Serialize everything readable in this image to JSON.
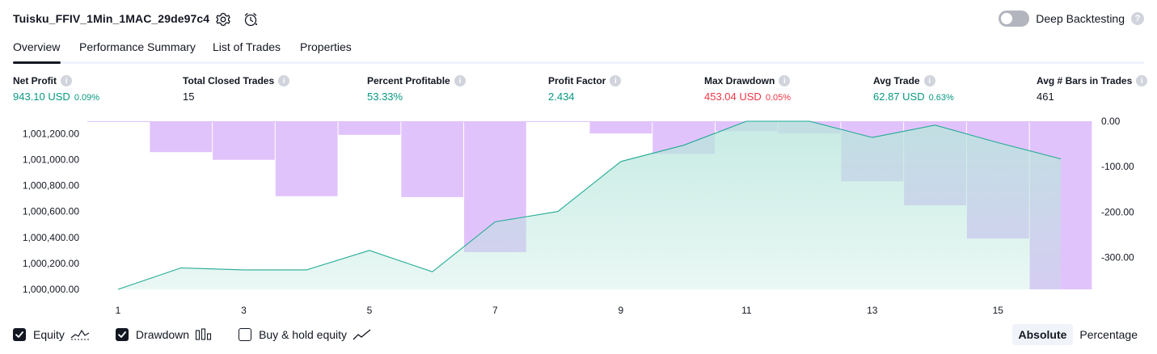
{
  "header": {
    "title": "Tuisku_FFIV_1Min_1MAC_29de97c4",
    "deep_backtesting_label": "Deep Backtesting",
    "deep_backtesting_enabled": false,
    "help_glyph": "?",
    "icons": [
      "settings-icon",
      "alert-clock-icon",
      "help-icon"
    ]
  },
  "tabs": [
    {
      "label": "Overview",
      "active": true
    },
    {
      "label": "Performance Summary",
      "active": false
    },
    {
      "label": "List of Trades",
      "active": false
    },
    {
      "label": "Properties",
      "active": false
    }
  ],
  "metrics": {
    "info_glyph": "i",
    "net_profit": {
      "label": "Net Profit",
      "value": "943.10 USD",
      "pct": "0.09%"
    },
    "total_closed_trades": {
      "label": "Total Closed Trades",
      "value": "15"
    },
    "percent_profitable": {
      "label": "Percent Profitable",
      "value": "53.33%"
    },
    "profit_factor": {
      "label": "Profit Factor",
      "value": "2.434"
    },
    "max_drawdown": {
      "label": "Max Drawdown",
      "value": "453.04 USD",
      "pct": "0.05%"
    },
    "avg_trade": {
      "label": "Avg Trade",
      "value": "62.87 USD",
      "pct": "0.63%"
    },
    "avg_bars": {
      "label": "Avg # Bars in Trades",
      "value": "461"
    }
  },
  "colors": {
    "green": "#089981",
    "red": "#f23645",
    "equity_line": "#22ab94",
    "equity_fill": "#b9e6dc",
    "drawdown_bar": "#e1c3fb"
  },
  "chart_data": {
    "type": "area",
    "x": [
      1,
      2,
      3,
      4,
      5,
      6,
      7,
      8,
      9,
      10,
      11,
      12,
      13,
      14,
      15,
      16
    ],
    "x_tick_labels": [
      "1",
      "3",
      "5",
      "7",
      "9",
      "11",
      "13",
      "15"
    ],
    "xlim": [
      1,
      16.55
    ],
    "series": [
      {
        "kind": "area",
        "axis": "left",
        "values": [
          1000000,
          1000165,
          1000150,
          1000150,
          1000300,
          1000135,
          1000520,
          1000600,
          1000985,
          1001110,
          1001295,
          1001295,
          1001170,
          1001265,
          1001130,
          1001005
        ]
      },
      {
        "kind": "bar",
        "axis": "right",
        "values": [
          0,
          -68,
          -85,
          -165,
          -30,
          -167,
          -288,
          0,
          -27,
          -72,
          -22,
          -27,
          -132,
          -185,
          -258,
          -370
        ]
      }
    ],
    "y_left": {
      "ticks": [
        "1,000,000.00",
        "1,000,200.00",
        "1,000,400.00",
        "1,000,600.00",
        "1,000,800.00",
        "1,001,000.00",
        "1,001,200.00"
      ],
      "lim": [
        1000000,
        1001295
      ]
    },
    "y_right": {
      "ticks": [
        "0.00",
        "-100.00",
        "-200.00",
        "-300.00"
      ],
      "lim": [
        -370,
        0
      ]
    },
    "grid": false
  },
  "legend": {
    "equity": {
      "label": "Equity",
      "checked": true
    },
    "drawdown": {
      "label": "Drawdown",
      "checked": true
    },
    "buy_hold": {
      "label": "Buy & hold equity",
      "checked": false
    }
  },
  "modes": {
    "absolute": "Absolute",
    "percentage": "Percentage",
    "active": "absolute"
  }
}
